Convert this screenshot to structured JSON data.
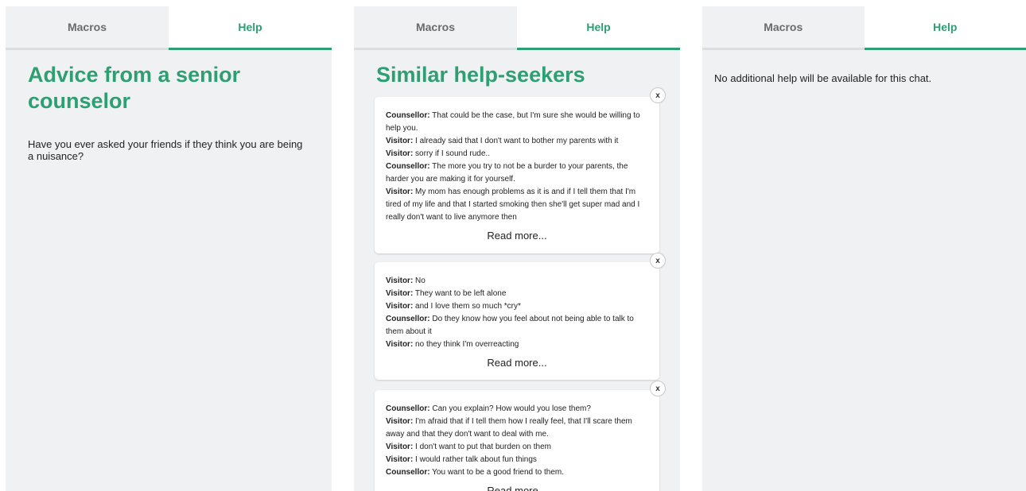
{
  "tabs": {
    "macros_label": "Macros",
    "help_label": "Help"
  },
  "panel1": {
    "title": "Advice from a senior counselor",
    "advice": "Have you ever asked your friends if they think you are being a nuisance?"
  },
  "panel2": {
    "title": "Similar help-seekers",
    "close_label": "x",
    "read_more_label": "Read more...",
    "cards": [
      {
        "lines": [
          {
            "speaker": "Counsellor:",
            "text": " That could be the case, but I'm sure she would be willing to help you."
          },
          {
            "speaker": "Visitor:",
            "text": " I already said that I don't want to bother my parents with it"
          },
          {
            "speaker": "Visitor:",
            "text": " sorry if I sound rude.."
          },
          {
            "speaker": "Counsellor:",
            "text": " The more you try to not be a burder to your parents, the harder you are making it for yourself."
          },
          {
            "speaker": "Visitor:",
            "text": " My mom has enough problems as it is and if I tell them that I'm tired of my life and that I started smoking then she'll get super mad and I really don't want to live anymore then"
          }
        ]
      },
      {
        "lines": [
          {
            "speaker": "Visitor:",
            "text": " No"
          },
          {
            "speaker": "Visitor:",
            "text": " They want to be left alone"
          },
          {
            "speaker": "Visitor:",
            "text": " and I love them so much *cry*"
          },
          {
            "speaker": "Counsellor:",
            "text": " Do they know how you feel about not being able to talk to them about it"
          },
          {
            "speaker": "Visitor:",
            "text": " no they think I'm overreacting"
          }
        ]
      },
      {
        "lines": [
          {
            "speaker": "Counsellor:",
            "text": " Can you explain? How would you lose them?"
          },
          {
            "speaker": "Visitor:",
            "text": " I'm afraid that if I tell them how I really feel, that I'll scare them away and that they don't want to deal with me."
          },
          {
            "speaker": "Visitor:",
            "text": " I don't want to put that burden on them"
          },
          {
            "speaker": "Visitor:",
            "text": " I would rather talk about fun things"
          },
          {
            "speaker": "Counsellor:",
            "text": " You want to be a good friend to them."
          }
        ]
      }
    ]
  },
  "panel3": {
    "message": "No additional help will be available for this chat."
  },
  "colors": {
    "accent": "#2e9e73",
    "panel_bg": "#f0f1f3"
  }
}
